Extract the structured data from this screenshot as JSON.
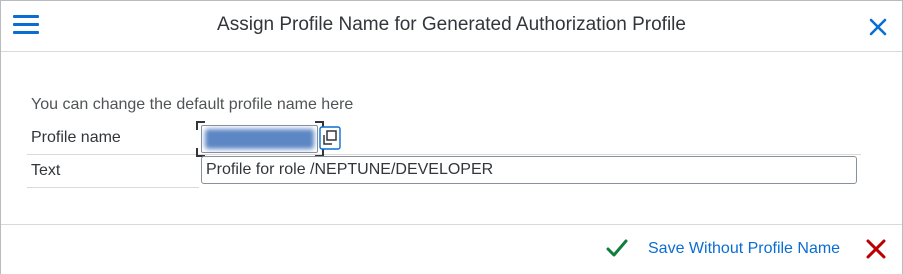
{
  "dialog": {
    "title": "Assign Profile Name for Generated Authorization Profile",
    "icons": {
      "menu": "hamburger-menu-icon",
      "close": "close-icon"
    }
  },
  "content": {
    "hint": "You can change the default profile name here",
    "profile_name": {
      "label": "Profile name",
      "value_redacted": true,
      "value_help_icon": "value-help-icon"
    },
    "text": {
      "label": "Text",
      "value": "Profile for role /NEPTUNE/DEVELOPER"
    }
  },
  "footer": {
    "confirm_icon": "checkmark-icon",
    "save_without_label": "Save Without Profile Name",
    "cancel_icon": "cancel-icon"
  },
  "colors": {
    "accent": "#0a6ed1",
    "confirm": "#107e3e",
    "cancel": "#bb0000",
    "text": "#32363a",
    "border": "#89919a"
  }
}
